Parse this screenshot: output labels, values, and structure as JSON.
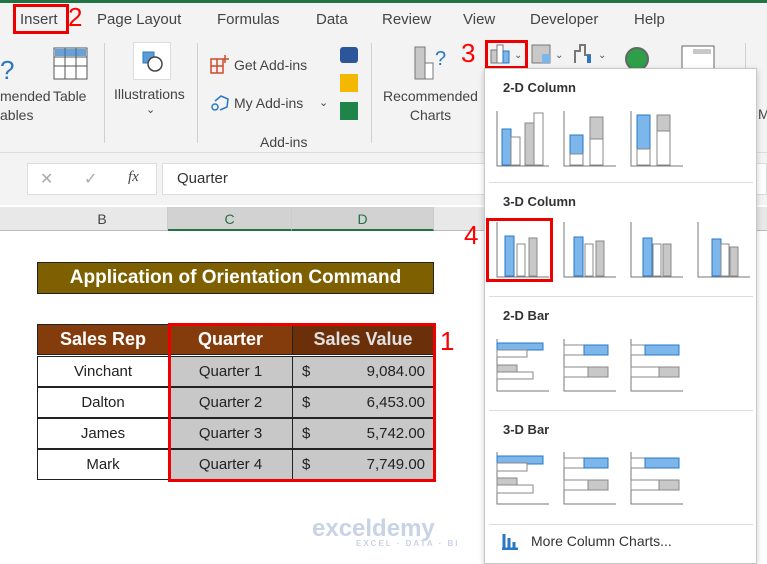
{
  "tabs": [
    "Insert",
    "Page Layout",
    "Formulas",
    "Data",
    "Review",
    "View",
    "Developer",
    "Help"
  ],
  "ribbon": {
    "pivot_partial": [
      "mended",
      "ables"
    ],
    "table": "Table",
    "illustrations": "Illustrations",
    "get_addins": "Get Add-ins",
    "my_addins": "My Add-ins",
    "addins_group": "Add-ins",
    "recommended_charts": [
      "Recommended",
      "Charts"
    ],
    "partial_right": "M"
  },
  "formula_bar": {
    "value": "Quarter",
    "fx": "fx"
  },
  "columns": [
    "B",
    "C",
    "D"
  ],
  "sheet": {
    "title": "Application of Orientation Command",
    "headers": [
      "Sales Rep",
      "Quarter",
      "Sales Value"
    ],
    "rows": [
      {
        "rep": "Vinchant",
        "quarter": "Quarter 1",
        "cur": "$",
        "value": "9,084.00"
      },
      {
        "rep": "Dalton",
        "quarter": "Quarter 2",
        "cur": "$",
        "value": "6,453.00"
      },
      {
        "rep": "James",
        "quarter": "Quarter 3",
        "cur": "$",
        "value": "5,742.00"
      },
      {
        "rep": "Mark",
        "quarter": "Quarter 4",
        "cur": "$",
        "value": "7,749.00"
      }
    ]
  },
  "steps": [
    "1",
    "2",
    "3",
    "4"
  ],
  "menu": {
    "sections": [
      "2-D Column",
      "3-D Column",
      "2-D Bar",
      "3-D Bar"
    ],
    "more": "More Column Charts..."
  },
  "watermark": {
    "name": "exceldemy",
    "tag": "EXCEL · DATA · BI"
  },
  "colors": {
    "accent": "#217346",
    "title_bg": "#7f6000",
    "header_bg": "#843c0c",
    "highlight": "#ff0000",
    "chart_blue": "#7cb6ea"
  }
}
